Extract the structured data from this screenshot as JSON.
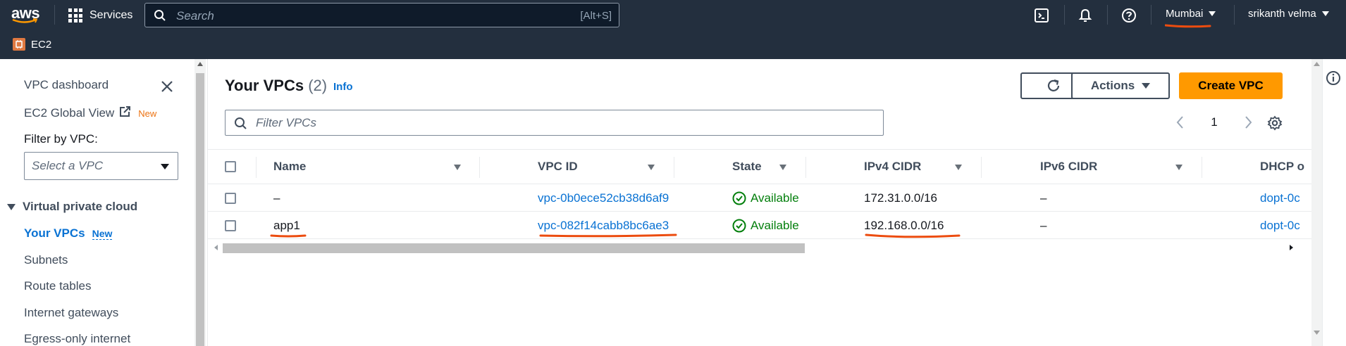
{
  "topnav": {
    "logo_text": "aws",
    "services_label": "Services",
    "search_placeholder": "Search",
    "search_shortcut": "[Alt+S]",
    "region": "Mumbai",
    "user": "srikanth velma"
  },
  "breadcrumb": {
    "service": "EC2"
  },
  "sidebar": {
    "dashboard": "VPC dashboard",
    "global_view": "EC2 Global View",
    "global_view_badge": "New",
    "filter_label": "Filter by VPC:",
    "filter_placeholder": "Select a VPC",
    "section": "Virtual private cloud",
    "items": [
      {
        "label": "Your VPCs",
        "badge": "New"
      },
      {
        "label": "Subnets"
      },
      {
        "label": "Route tables"
      },
      {
        "label": "Internet gateways"
      },
      {
        "label": "Egress-only internet"
      }
    ]
  },
  "main": {
    "title": "Your VPCs",
    "count": "(2)",
    "info": "Info",
    "actions_label": "Actions",
    "create_label": "Create VPC",
    "filter_placeholder": "Filter VPCs",
    "page": "1"
  },
  "table": {
    "columns": [
      "Name",
      "VPC ID",
      "State",
      "IPv4 CIDR",
      "IPv6 CIDR",
      "DHCP o"
    ],
    "rows": [
      {
        "name": "–",
        "vpc_id": "vpc-0b0ece52cb38d6af9",
        "state": "Available",
        "ipv4": "172.31.0.0/16",
        "ipv6": "–",
        "dhcp": "dopt-0c"
      },
      {
        "name": "app1",
        "vpc_id": "vpc-082f14cabb8bc6ae3",
        "state": "Available",
        "ipv4": "192.168.0.0/16",
        "ipv6": "–",
        "dhcp": "dopt-0c"
      }
    ]
  },
  "colors": {
    "nav_bg": "#232f3e",
    "link": "#0972d3",
    "primary": "#ff9900",
    "success": "#037f0c",
    "annotation": "#ec4c0f"
  }
}
